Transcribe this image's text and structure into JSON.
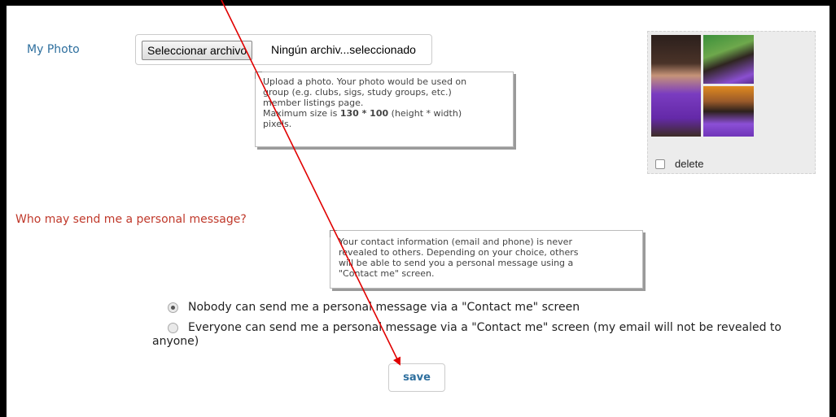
{
  "photo": {
    "label": "My Photo",
    "choose_button": "Seleccionar archivo",
    "file_status": "Ningún archiv...seleccionado",
    "delete_label": "delete"
  },
  "tooltip_photo": {
    "line1": "Upload a photo. Your photo would be used on",
    "line2": "group (e.g. clubs, sigs, study groups, etc.)",
    "line3": "member listings page.",
    "line4_pre": "Maximum size is ",
    "size_value": "130 * 100",
    "line4_post": " (height * width)",
    "line5": "pixels."
  },
  "messaging": {
    "question": "Who may send me a personal message?",
    "tooltip": {
      "line1": "Your contact information (email and phone) is never",
      "line2": "revealed to others. Depending on your choice, others",
      "line3": "will be able to send you a personal message using a",
      "line4": "\"Contact me\" screen."
    },
    "options": [
      {
        "label": "Nobody can send me a personal message via a \"Contact me\" screen",
        "selected": true
      },
      {
        "label": "Everyone can send me a personal message via a \"Contact me\" screen (my email will not be revealed to",
        "label_cont": "anyone)",
        "selected": false
      }
    ]
  },
  "save_label": "save",
  "colors": {
    "link_blue": "#2e6f9e",
    "question_red": "#c0392b",
    "annotation_red": "#e00000"
  }
}
